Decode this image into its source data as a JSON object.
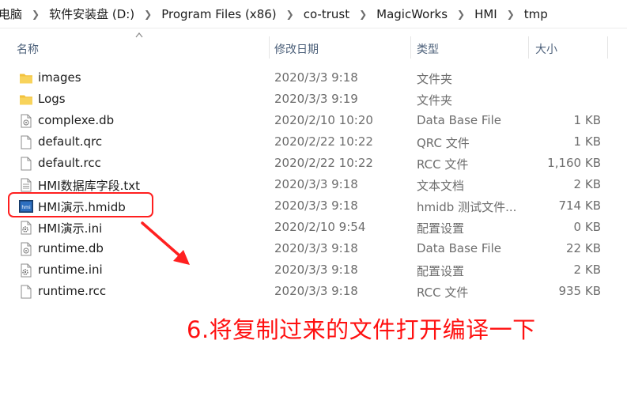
{
  "breadcrumb": [
    "电脑",
    "软件安装盘 (D:)",
    "Program Files (x86)",
    "co-trust",
    "MagicWorks",
    "HMI",
    "tmp"
  ],
  "columns": {
    "name": "名称",
    "date": "修改日期",
    "type": "类型",
    "size": "大小"
  },
  "files": [
    {
      "name": "images",
      "date": "2020/3/3 9:18",
      "type": "文件夹",
      "size": "",
      "icon": "folder-icon"
    },
    {
      "name": "Logs",
      "date": "2020/3/3 9:19",
      "type": "文件夹",
      "size": "",
      "icon": "folder-icon"
    },
    {
      "name": "complexe.db",
      "date": "2020/2/10 10:20",
      "type": "Data Base File",
      "size": "1 KB",
      "icon": "database-file-icon"
    },
    {
      "name": "default.qrc",
      "date": "2020/2/22 10:22",
      "type": "QRC 文件",
      "size": "1 KB",
      "icon": "file-icon"
    },
    {
      "name": "default.rcc",
      "date": "2020/2/22 10:22",
      "type": "RCC 文件",
      "size": "1,160 KB",
      "icon": "file-icon"
    },
    {
      "name": "HMI数据库字段.txt",
      "date": "2020/3/3 9:18",
      "type": "文本文档",
      "size": "2 KB",
      "icon": "text-file-icon"
    },
    {
      "name": "HMI演示.hmidb",
      "date": "2020/3/3 9:18",
      "type": "hmidb 测试文件...",
      "size": "714 KB",
      "icon": "hmidb-file-icon"
    },
    {
      "name": "HMI演示.ini",
      "date": "2020/2/10 9:54",
      "type": "配置设置",
      "size": "0 KB",
      "icon": "settings-file-icon"
    },
    {
      "name": "runtime.db",
      "date": "2020/3/3 9:18",
      "type": "Data Base File",
      "size": "22 KB",
      "icon": "database-file-icon"
    },
    {
      "name": "runtime.ini",
      "date": "2020/3/3 9:18",
      "type": "配置设置",
      "size": "2 KB",
      "icon": "settings-file-icon"
    },
    {
      "name": "runtime.rcc",
      "date": "2020/3/3 9:18",
      "type": "RCC 文件",
      "size": "935 KB",
      "icon": "file-icon"
    }
  ],
  "annotation": "6.将复制过来的文件打开编译一下",
  "colors": {
    "annotation": "#ff1010",
    "folder": "#f3c23c",
    "header_text": "#4c607a"
  }
}
